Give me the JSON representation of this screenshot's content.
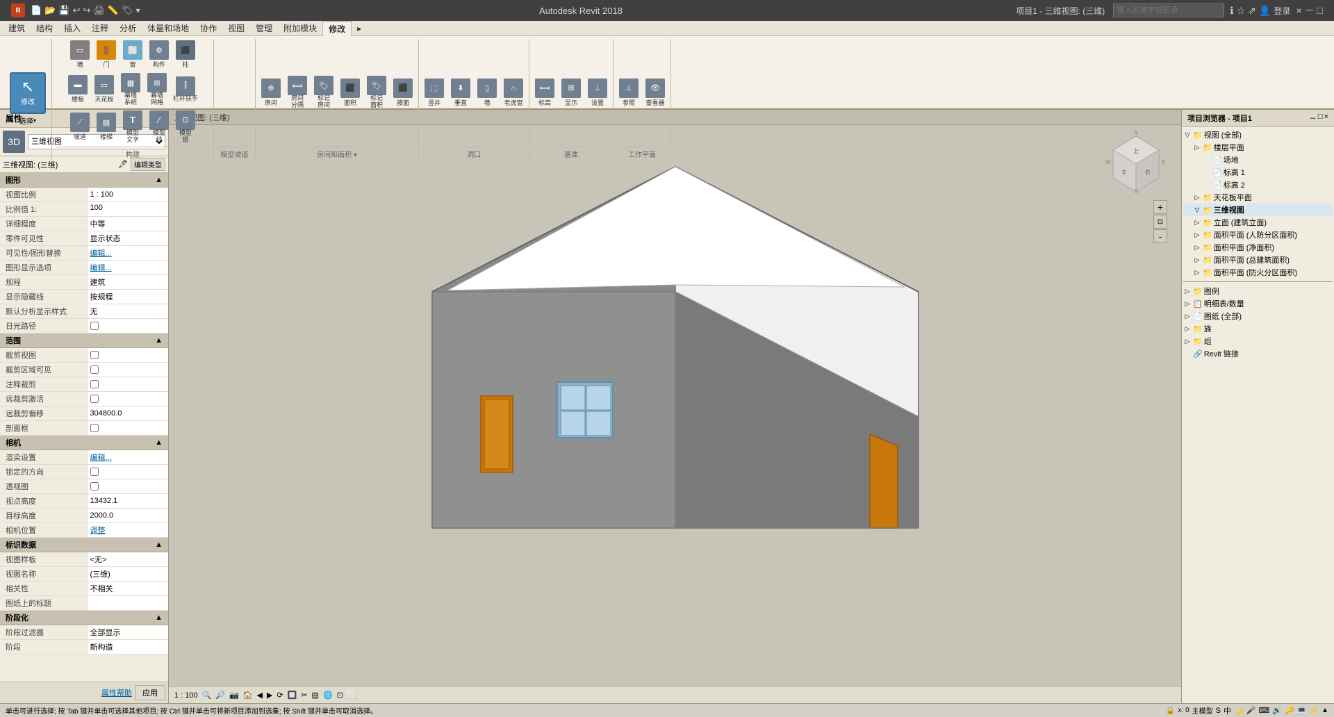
{
  "titlebar": {
    "app_name": "Autodesk Revit 2018",
    "project": "项目1 - 三维视图: (三维)",
    "search_placeholder": "键入关键字或短语",
    "login": "登录",
    "minimize": "－",
    "restore": "□",
    "close": "×"
  },
  "menubar": {
    "items": [
      "建筑",
      "结构",
      "插入",
      "注释",
      "分析",
      "体量和场地",
      "协作",
      "视图",
      "管理",
      "附加模块",
      "修改",
      ""
    ]
  },
  "ribbon": {
    "active_tab": "修改",
    "tabs": [
      "建筑",
      "结构",
      "插入",
      "注释",
      "分析",
      "体量和场地",
      "协作",
      "视图",
      "管理",
      "附加模块",
      "修改"
    ],
    "select_label": "修改",
    "groups": [
      {
        "label": "构建",
        "tools": [
          "墙",
          "门",
          "窗",
          "构件",
          "柱",
          "楼板",
          "天花板",
          "幕墙系统",
          "幕墙网格",
          "栏杆扶手",
          "坡道",
          "楼梯",
          "模型文字",
          "模型线",
          "模型组"
        ]
      },
      {
        "label": "房间和面积",
        "tools": [
          "房间",
          "房间分隔",
          "标记房间",
          "面积",
          "标记面积",
          "按面"
        ]
      },
      {
        "label": "洞口",
        "tools": [
          "竖井",
          "垂直",
          "墙",
          "老虎窗"
        ]
      },
      {
        "label": "基准",
        "tools": [
          "标高",
          "显示",
          "设置"
        ]
      },
      {
        "label": "工作平面",
        "tools": [
          "参照",
          "查看器"
        ]
      }
    ]
  },
  "properties": {
    "title": "属性",
    "type_selector": "三维视图",
    "view_type_label": "三维视图: (三维)",
    "edit_type_btn": "编辑类型",
    "sections": [
      {
        "name": "图形",
        "expanded": true,
        "rows": [
          {
            "label": "视图比例",
            "value": "1 : 100",
            "editable": true
          },
          {
            "label": "比例值 1:",
            "value": "100",
            "editable": false
          },
          {
            "label": "详细程度",
            "value": "中等",
            "editable": true
          },
          {
            "label": "零件可见性",
            "value": "显示状态",
            "editable": true
          },
          {
            "label": "可见性/图形替换",
            "value": "编辑...",
            "editable": true,
            "is_link": true
          },
          {
            "label": "图形显示选项",
            "value": "编辑...",
            "editable": true,
            "is_link": true
          },
          {
            "label": "规程",
            "value": "建筑",
            "editable": true
          },
          {
            "label": "显示隐藏线",
            "value": "按规程",
            "editable": true
          },
          {
            "label": "默认分析显示样式",
            "value": "无",
            "editable": true
          },
          {
            "label": "日光路径",
            "value": "",
            "editable": true,
            "is_checkbox": true
          }
        ]
      },
      {
        "name": "范围",
        "expanded": true,
        "rows": [
          {
            "label": "截剪视图",
            "value": "",
            "is_checkbox": true
          },
          {
            "label": "截剪区域可见",
            "value": "",
            "is_checkbox": true
          },
          {
            "label": "注释裁剪",
            "value": "",
            "is_checkbox": true
          },
          {
            "label": "远裁剪激活",
            "value": "",
            "is_checkbox": true
          },
          {
            "label": "远裁剪偏移",
            "value": "304800.0",
            "editable": true
          },
          {
            "label": "剖面框",
            "value": "",
            "is_checkbox": true
          }
        ]
      },
      {
        "name": "相机",
        "expanded": true,
        "rows": [
          {
            "label": "渲染设置",
            "value": "编辑...",
            "is_link": true
          },
          {
            "label": "锁定的方向",
            "value": "",
            "is_checkbox": true
          },
          {
            "label": "透视图",
            "value": "",
            "is_checkbox": true
          },
          {
            "label": "视点高度",
            "value": "13432.1",
            "editable": true
          },
          {
            "label": "目标高度",
            "value": "2000.0",
            "editable": true
          },
          {
            "label": "相机位置",
            "value": "调整",
            "is_link": true
          }
        ]
      },
      {
        "name": "标识数据",
        "expanded": true,
        "rows": [
          {
            "label": "视图样板",
            "value": "<无>",
            "editable": true
          },
          {
            "label": "视图名称",
            "value": "(三维)",
            "editable": true
          },
          {
            "label": "相关性",
            "value": "不相关",
            "editable": false
          },
          {
            "label": "图纸上的标题",
            "value": "",
            "editable": true
          }
        ]
      },
      {
        "name": "阶段化",
        "expanded": true,
        "rows": [
          {
            "label": "阶段过滤器",
            "value": "全部显示",
            "editable": true
          },
          {
            "label": "阶段",
            "value": "新构造",
            "editable": true
          }
        ]
      }
    ],
    "footer": {
      "help_link": "属性帮助",
      "apply_btn": "应用"
    }
  },
  "canvas": {
    "scale_text": "1 : 100",
    "toolbar_items": [
      "1 : 100",
      "🔍",
      "🔎",
      "📷",
      "🏠",
      "◀",
      "▶",
      "⟳",
      "🔲",
      "✂",
      "▤",
      "🌐"
    ],
    "view_title": "三维视图: (三维)"
  },
  "project_browser": {
    "title": "项目浏览器 - 项目1",
    "tree": [
      {
        "level": 0,
        "expand": "▽",
        "icon": "📁",
        "label": "视图 (全部)"
      },
      {
        "level": 1,
        "expand": "▷",
        "icon": "📁",
        "label": "楼层平面"
      },
      {
        "level": 2,
        "expand": "",
        "icon": "📄",
        "label": "场地"
      },
      {
        "level": 2,
        "expand": "",
        "icon": "📄",
        "label": "标高 1"
      },
      {
        "level": 2,
        "expand": "",
        "icon": "📄",
        "label": "标高 2"
      },
      {
        "level": 1,
        "expand": "▷",
        "icon": "📁",
        "label": "天花板平面"
      },
      {
        "level": 1,
        "expand": "▽",
        "icon": "📁",
        "label": "三维视图"
      },
      {
        "level": 1,
        "expand": "▷",
        "icon": "📁",
        "label": "立面 (建筑立面)"
      },
      {
        "level": 1,
        "expand": "▷",
        "icon": "📁",
        "label": "面积平面 (人防分区面积)"
      },
      {
        "level": 1,
        "expand": "▷",
        "icon": "📁",
        "label": "面积平面 (净面积)"
      },
      {
        "level": 1,
        "expand": "▷",
        "icon": "📁",
        "label": "面积平面 (总建筑面积)"
      },
      {
        "level": 1,
        "expand": "▷",
        "icon": "📁",
        "label": "面积平面 (防火分区面积)"
      },
      {
        "level": 0,
        "expand": "▷",
        "icon": "📁",
        "label": "图例"
      },
      {
        "level": 0,
        "expand": "▷",
        "icon": "📋",
        "label": "明细表/数量"
      },
      {
        "level": 0,
        "expand": "▷",
        "icon": "📄",
        "label": "图纸 (全部)"
      },
      {
        "level": 0,
        "expand": "▷",
        "icon": "📁",
        "label": "族"
      },
      {
        "level": 0,
        "expand": "▷",
        "icon": "📁",
        "label": "组"
      },
      {
        "level": 0,
        "expand": "",
        "icon": "🔗",
        "label": "Revit 链接"
      }
    ]
  },
  "statusbar": {
    "message": "单击可进行选择; 按 Tab 键并单击可选择其他项目; 按 Ctrl 键并单击可将新项目添加到选集; 按 Shift 键并单击可取消选择。",
    "coords": "x: 0",
    "model": "主模型",
    "scale_btn": "1:100"
  },
  "icons": {
    "wall": "▭",
    "door": "🚪",
    "window": "⬜",
    "component": "⚙",
    "column": "⬆",
    "floor": "▬",
    "ceiling": "▭",
    "curtain_system": "▦",
    "curtain_grid": "⊞",
    "railing": "⫿",
    "ramp": "⟋",
    "stair": "▤",
    "model_text": "T",
    "model_line": "∕",
    "model_group": "⊡",
    "room": "⊕",
    "room_sep": "⟺",
    "tag_room": "🏷",
    "area": "⬛",
    "tag_area": "🏷",
    "shaft": "⬚",
    "vertical": "⬇",
    "wall_opening": "▯",
    "dormer": "⌂",
    "grid": "⊞",
    "level": "⟺",
    "ref_plane": "⊥",
    "viewer": "👁"
  }
}
